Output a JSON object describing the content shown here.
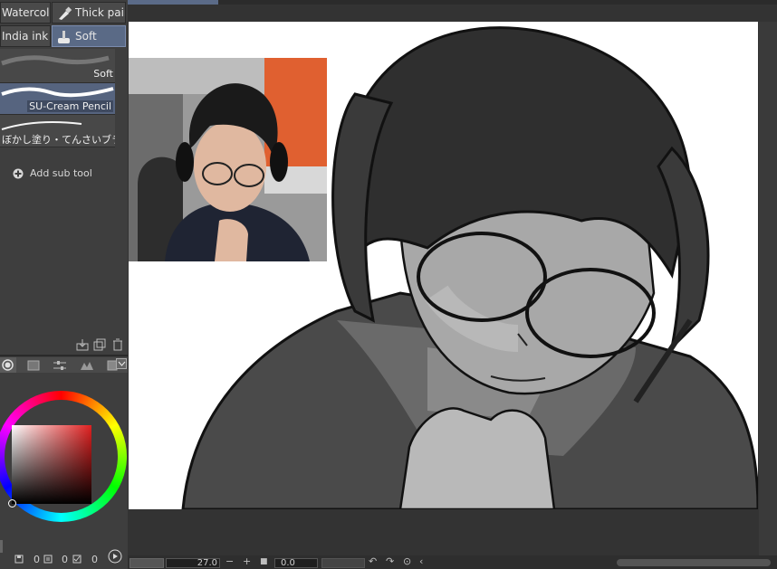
{
  "subtool_tabs": [
    {
      "label": "Watercolor",
      "icon": "brush-icon"
    },
    {
      "label": "Thick paint",
      "icon": "paint-tube-icon"
    },
    {
      "label": "India ink",
      "icon": "pen-icon"
    },
    {
      "label": "Soft",
      "icon": "soft-brush-icon",
      "selected": true
    }
  ],
  "brushes": [
    {
      "label": "Soft",
      "selected": false
    },
    {
      "label": "SU-Cream Pencil",
      "selected": true
    },
    {
      "label": "ぼかし塗り・てんさいブラシ",
      "selected": false
    }
  ],
  "add_sub_tool": "Add sub tool",
  "color_wheel": {
    "current_color": "#ffffff",
    "hue_color": "#e02020"
  },
  "color_values": [
    "0",
    "0",
    "0"
  ],
  "status": {
    "zoom": "27.0",
    "rotation": "0.0"
  },
  "colors": {
    "accent": "#5b6b88",
    "panel": "#3e3e3e",
    "canvas_bg": "#333333"
  }
}
